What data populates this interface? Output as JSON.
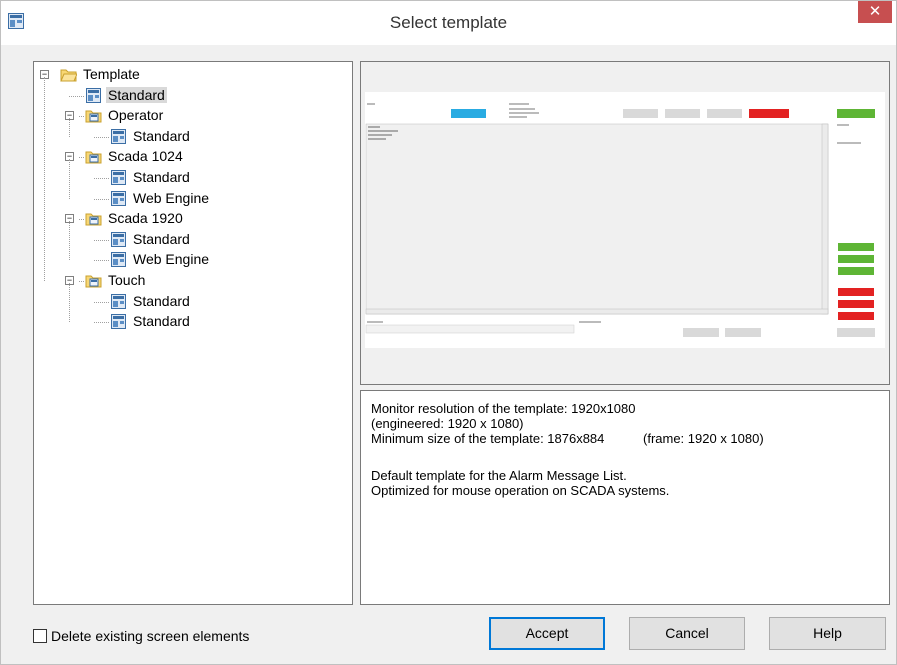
{
  "window": {
    "title": "Select template",
    "close_symbol": "✕"
  },
  "tree": {
    "nodes": [
      {
        "label": "Template",
        "type": "folder",
        "level": 0,
        "expandable": true
      },
      {
        "label": "Standard",
        "type": "template",
        "level": 1,
        "selected": true
      },
      {
        "label": "Operator",
        "type": "folder",
        "level": 1,
        "expandable": true
      },
      {
        "label": "Standard",
        "type": "template",
        "level": 2
      },
      {
        "label": "Scada 1024",
        "type": "folder",
        "level": 1,
        "expandable": true
      },
      {
        "label": "Standard",
        "type": "template",
        "level": 2
      },
      {
        "label": "Web Engine",
        "type": "template",
        "level": 2
      },
      {
        "label": "Scada 1920",
        "type": "folder",
        "level": 1,
        "expandable": true
      },
      {
        "label": "Standard",
        "type": "template",
        "level": 2
      },
      {
        "label": "Web Engine",
        "type": "template",
        "level": 2
      },
      {
        "label": "Touch",
        "type": "folder",
        "level": 1,
        "expandable": true
      },
      {
        "label": "Standard",
        "type": "template",
        "level": 2
      },
      {
        "label": "Standard",
        "type": "template",
        "level": 2
      }
    ]
  },
  "description": {
    "line1": "Monitor resolution of the template: 1920x1080",
    "line2": "(engineered: 1920 x 1080)",
    "line3": "Minimum size of the template: 1876x884",
    "line3b": "(frame: 1920 x 1080)",
    "line4": "Default template for the Alarm Message List.",
    "line5": "Optimized for mouse operation on SCADA systems."
  },
  "options": {
    "delete_existing_label": "Delete existing screen elements",
    "delete_existing_checked": false
  },
  "buttons": {
    "accept": "Accept",
    "cancel": "Cancel",
    "help": "Help"
  },
  "colors": {
    "accent": "#0078d7",
    "close": "#c74f50",
    "preview_blue": "#29abe2",
    "preview_red": "#e32222",
    "preview_green": "#5eb535"
  }
}
